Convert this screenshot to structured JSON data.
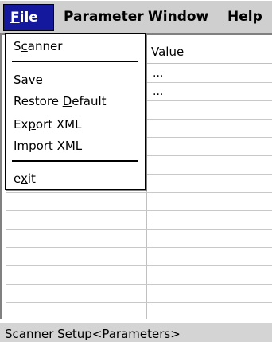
{
  "menubar": {
    "file": {
      "accel": "F",
      "rest": "ile"
    },
    "parameter": {
      "accel": "P",
      "rest": "arameter"
    },
    "window": {
      "accel": "W",
      "rest": "indow"
    },
    "help": {
      "accel": "H",
      "rest": "elp"
    }
  },
  "file_menu": {
    "scanner": {
      "pre": "S",
      "accel": "c",
      "post": "anner"
    },
    "save": {
      "pre": "",
      "accel": "S",
      "post": "ave"
    },
    "restore_default": {
      "pre": "Restore ",
      "accel": "D",
      "post": "efault"
    },
    "export_xml": {
      "pre": "Ex",
      "accel": "p",
      "post": "ort XML"
    },
    "import_xml": {
      "pre": "I",
      "accel": "m",
      "post": "port XML"
    },
    "exit": {
      "pre": "e",
      "accel": "x",
      "post": "it"
    }
  },
  "grid": {
    "header_value": "Value",
    "rows": [
      "...",
      "..."
    ]
  },
  "statusbar": {
    "text": "Scanner Setup<Parameters>"
  }
}
